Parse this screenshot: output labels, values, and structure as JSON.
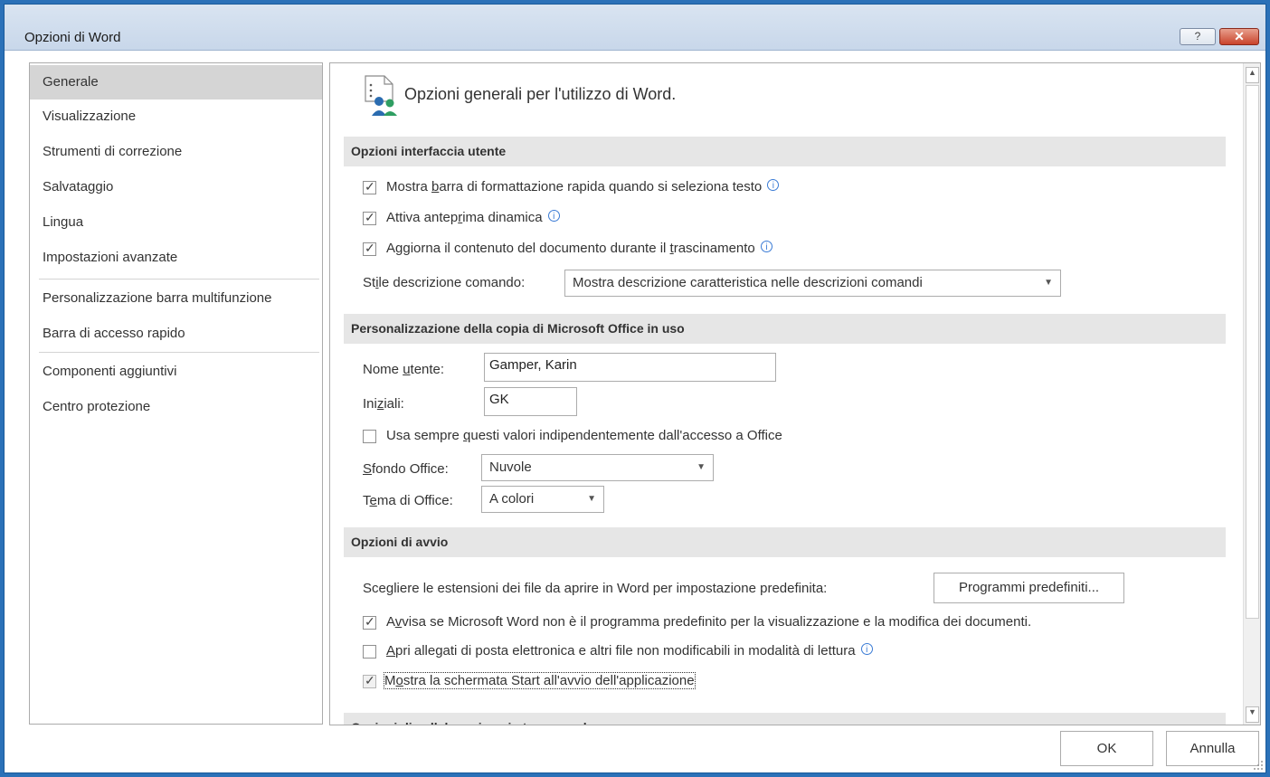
{
  "window": {
    "title": "Opzioni di Word",
    "help_label": "?",
    "close_label": "✕"
  },
  "sidebar": {
    "items": [
      {
        "label": "Generale"
      },
      {
        "label": "Visualizzazione"
      },
      {
        "label": "Strumenti di correzione"
      },
      {
        "label": "Salvataggio"
      },
      {
        "label": "Lingua"
      },
      {
        "label": "Impostazioni avanzate"
      },
      {
        "label": "Personalizzazione barra multifunzione"
      },
      {
        "label": "Barra di accesso rapido"
      },
      {
        "label": "Componenti aggiuntivi"
      },
      {
        "label": "Centro protezione"
      }
    ],
    "selected": "Generale"
  },
  "main": {
    "header": "Opzioni generali per l'utilizzo di Word.",
    "sections": {
      "ui": {
        "title": "Opzioni interfaccia utente",
        "mini_toolbar": {
          "pre": "Mostra ",
          "u": "b",
          "post": "arra di formattazione rapida quando si seleziona testo",
          "checked": true
        },
        "live_preview": {
          "pre": "Attiva antep",
          "u": "r",
          "post": "ima dinamica",
          "checked": true
        },
        "update_drag": {
          "pre": "Aggiorna il contenuto del documento durante il ",
          "u": "t",
          "post": "rascinamento",
          "checked": true
        },
        "screentip_label": {
          "pre": "St",
          "u": "i",
          "post": "le descrizione comando:"
        },
        "screentip_value": "Mostra descrizione caratteristica nelle descrizioni comandi"
      },
      "personalize": {
        "title": "Personalizzazione della copia di Microsoft Office in uso",
        "username_label": {
          "pre": "Nome ",
          "u": "u",
          "post": "tente:"
        },
        "username_value": "Gamper, Karin",
        "initials_label": {
          "pre": "Ini",
          "u": "z",
          "post": "iali:"
        },
        "initials_value": "GK",
        "always_use": {
          "pre": "Usa sempre ",
          "u": "q",
          "post": "uesti valori indipendentemente dall'accesso a Office",
          "checked": false
        },
        "background_label": {
          "pre": "",
          "u": "S",
          "post": "fondo Office:"
        },
        "background_value": "Nuvole",
        "theme_label": {
          "pre": "T",
          "u": "e",
          "post": "ma di Office:"
        },
        "theme_value": "A colori"
      },
      "startup": {
        "title": "Opzioni di avvio",
        "extensions_text": "Scegliere le estensioni dei file da aprire in Word per impostazione predefinita:",
        "default_programs_button": "Programmi predefiniti...",
        "warn_default": {
          "pre": "A",
          "u": "v",
          "post": "visa se Microsoft Word non è il programma predefinito per la visualizzazione e la modifica dei documenti.",
          "checked": true
        },
        "open_attachments": {
          "pre": "",
          "u": "A",
          "post": "pri allegati di posta elettronica e altri file non modificabili in modalità di lettura",
          "checked": false
        },
        "show_start": {
          "pre": "M",
          "u": "o",
          "post": "stra la schermata Start all'avvio dell'applicazione",
          "checked": true
        },
        "collab_title": "Opzioni di collaborazione in tempo reale"
      }
    }
  },
  "footer": {
    "ok_label": "OK",
    "cancel_label": "Annulla"
  },
  "icons": {
    "info": "info-icon",
    "header": "options-icon"
  },
  "colors": {
    "accent": "#2b71b8",
    "section_bg": "#e6e6e6",
    "selected_nav": "#d5d5d5"
  }
}
